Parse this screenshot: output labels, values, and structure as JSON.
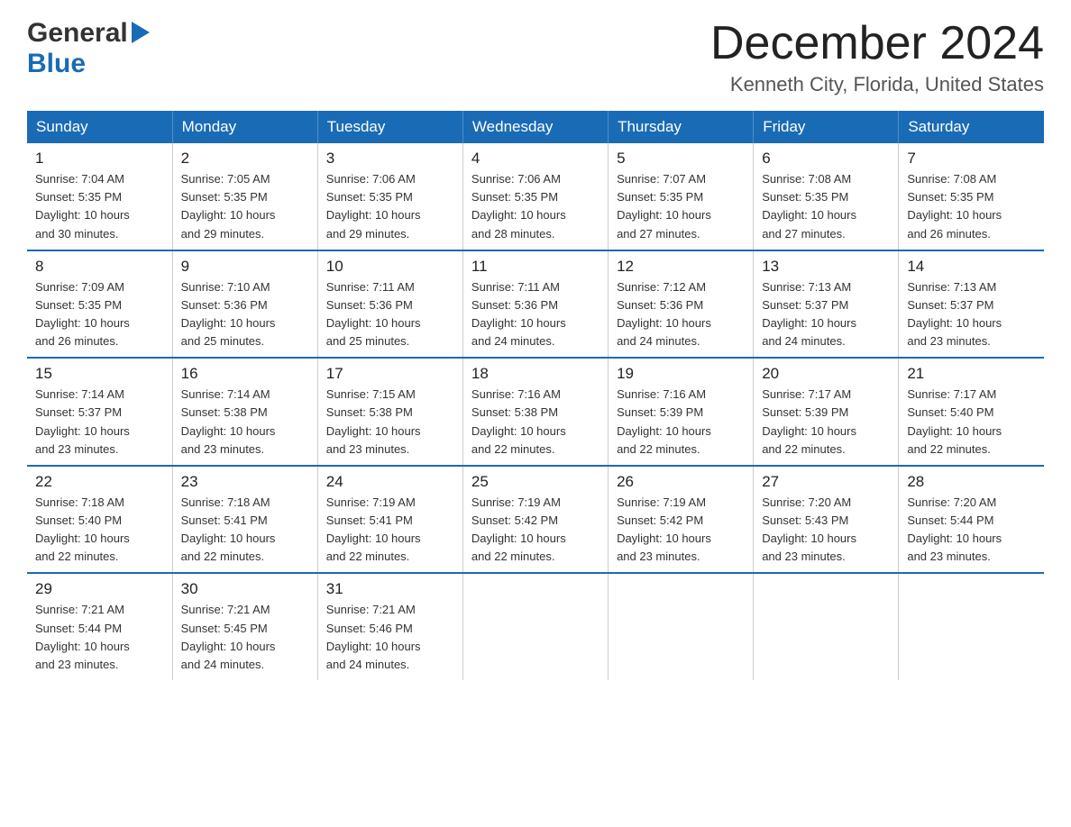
{
  "header": {
    "logo_general": "General",
    "logo_blue": "Blue",
    "month_title": "December 2024",
    "location": "Kenneth City, Florida, United States"
  },
  "days_of_week": [
    "Sunday",
    "Monday",
    "Tuesday",
    "Wednesday",
    "Thursday",
    "Friday",
    "Saturday"
  ],
  "weeks": [
    [
      {
        "day": "1",
        "sunrise": "7:04 AM",
        "sunset": "5:35 PM",
        "daylight": "10 hours and 30 minutes."
      },
      {
        "day": "2",
        "sunrise": "7:05 AM",
        "sunset": "5:35 PM",
        "daylight": "10 hours and 29 minutes."
      },
      {
        "day": "3",
        "sunrise": "7:06 AM",
        "sunset": "5:35 PM",
        "daylight": "10 hours and 29 minutes."
      },
      {
        "day": "4",
        "sunrise": "7:06 AM",
        "sunset": "5:35 PM",
        "daylight": "10 hours and 28 minutes."
      },
      {
        "day": "5",
        "sunrise": "7:07 AM",
        "sunset": "5:35 PM",
        "daylight": "10 hours and 27 minutes."
      },
      {
        "day": "6",
        "sunrise": "7:08 AM",
        "sunset": "5:35 PM",
        "daylight": "10 hours and 27 minutes."
      },
      {
        "day": "7",
        "sunrise": "7:08 AM",
        "sunset": "5:35 PM",
        "daylight": "10 hours and 26 minutes."
      }
    ],
    [
      {
        "day": "8",
        "sunrise": "7:09 AM",
        "sunset": "5:35 PM",
        "daylight": "10 hours and 26 minutes."
      },
      {
        "day": "9",
        "sunrise": "7:10 AM",
        "sunset": "5:36 PM",
        "daylight": "10 hours and 25 minutes."
      },
      {
        "day": "10",
        "sunrise": "7:11 AM",
        "sunset": "5:36 PM",
        "daylight": "10 hours and 25 minutes."
      },
      {
        "day": "11",
        "sunrise": "7:11 AM",
        "sunset": "5:36 PM",
        "daylight": "10 hours and 24 minutes."
      },
      {
        "day": "12",
        "sunrise": "7:12 AM",
        "sunset": "5:36 PM",
        "daylight": "10 hours and 24 minutes."
      },
      {
        "day": "13",
        "sunrise": "7:13 AM",
        "sunset": "5:37 PM",
        "daylight": "10 hours and 24 minutes."
      },
      {
        "day": "14",
        "sunrise": "7:13 AM",
        "sunset": "5:37 PM",
        "daylight": "10 hours and 23 minutes."
      }
    ],
    [
      {
        "day": "15",
        "sunrise": "7:14 AM",
        "sunset": "5:37 PM",
        "daylight": "10 hours and 23 minutes."
      },
      {
        "day": "16",
        "sunrise": "7:14 AM",
        "sunset": "5:38 PM",
        "daylight": "10 hours and 23 minutes."
      },
      {
        "day": "17",
        "sunrise": "7:15 AM",
        "sunset": "5:38 PM",
        "daylight": "10 hours and 23 minutes."
      },
      {
        "day": "18",
        "sunrise": "7:16 AM",
        "sunset": "5:38 PM",
        "daylight": "10 hours and 22 minutes."
      },
      {
        "day": "19",
        "sunrise": "7:16 AM",
        "sunset": "5:39 PM",
        "daylight": "10 hours and 22 minutes."
      },
      {
        "day": "20",
        "sunrise": "7:17 AM",
        "sunset": "5:39 PM",
        "daylight": "10 hours and 22 minutes."
      },
      {
        "day": "21",
        "sunrise": "7:17 AM",
        "sunset": "5:40 PM",
        "daylight": "10 hours and 22 minutes."
      }
    ],
    [
      {
        "day": "22",
        "sunrise": "7:18 AM",
        "sunset": "5:40 PM",
        "daylight": "10 hours and 22 minutes."
      },
      {
        "day": "23",
        "sunrise": "7:18 AM",
        "sunset": "5:41 PM",
        "daylight": "10 hours and 22 minutes."
      },
      {
        "day": "24",
        "sunrise": "7:19 AM",
        "sunset": "5:41 PM",
        "daylight": "10 hours and 22 minutes."
      },
      {
        "day": "25",
        "sunrise": "7:19 AM",
        "sunset": "5:42 PM",
        "daylight": "10 hours and 22 minutes."
      },
      {
        "day": "26",
        "sunrise": "7:19 AM",
        "sunset": "5:42 PM",
        "daylight": "10 hours and 23 minutes."
      },
      {
        "day": "27",
        "sunrise": "7:20 AM",
        "sunset": "5:43 PM",
        "daylight": "10 hours and 23 minutes."
      },
      {
        "day": "28",
        "sunrise": "7:20 AM",
        "sunset": "5:44 PM",
        "daylight": "10 hours and 23 minutes."
      }
    ],
    [
      {
        "day": "29",
        "sunrise": "7:21 AM",
        "sunset": "5:44 PM",
        "daylight": "10 hours and 23 minutes."
      },
      {
        "day": "30",
        "sunrise": "7:21 AM",
        "sunset": "5:45 PM",
        "daylight": "10 hours and 24 minutes."
      },
      {
        "day": "31",
        "sunrise": "7:21 AM",
        "sunset": "5:46 PM",
        "daylight": "10 hours and 24 minutes."
      },
      null,
      null,
      null,
      null
    ]
  ],
  "labels": {
    "sunrise": "Sunrise:",
    "sunset": "Sunset:",
    "daylight": "Daylight:"
  }
}
